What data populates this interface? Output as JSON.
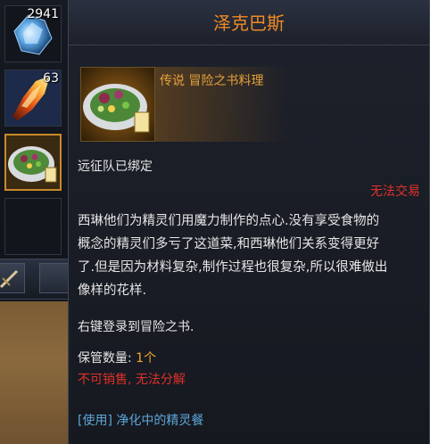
{
  "inventory": {
    "slots": [
      {
        "name": "crystal",
        "count": "2941"
      },
      {
        "name": "flame-crystal",
        "count": "63"
      },
      {
        "name": "salad-plate",
        "count": ""
      },
      {
        "name": "empty",
        "count": ""
      }
    ]
  },
  "tooltip": {
    "title": "泽克巴斯",
    "category": "传说 冒险之书料理",
    "binding": "远征队已绑定",
    "trade": "无法交易",
    "description": [
      "西琳他们为精灵们用魔力制作的点心.没有享受食物的",
      "概念的精灵们多亏了这道菜,和西琳他们关系变得更好",
      "了.但是因为材料复杂,制作过程也很复杂,所以很难做出",
      "像样的花样."
    ],
    "register_hint": "右键登录到冒险之书.",
    "storage_label": "保管数量: ",
    "storage_value": "1个",
    "sell_restriction": "不可销售, ",
    "disassemble_restriction": "无法分解",
    "use_tag": "[使用]",
    "use_effect": " 净化中的精灵餐"
  },
  "colors": {
    "title": "#ef8a26",
    "category": "#e6a13b",
    "restriction": "#e0312a",
    "use": "#5da7d8"
  }
}
